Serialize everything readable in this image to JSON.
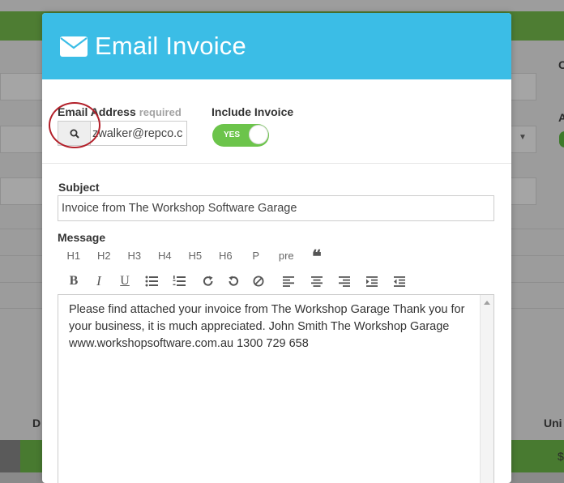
{
  "modal": {
    "title": "Email Invoice",
    "icon": "envelope-icon",
    "header_color": "#3bbde6"
  },
  "email": {
    "label": "Email Address",
    "required_label": "required",
    "value": "zwalker@repco.c",
    "search_icon": "search-icon"
  },
  "include_invoice": {
    "label": "Include Invoice",
    "toggle_text": "YES",
    "on_color": "#6cc44b"
  },
  "subject": {
    "label": "Subject",
    "value": "Invoice from The Workshop Software Garage"
  },
  "message": {
    "label": "Message",
    "headings": [
      "H1",
      "H2",
      "H3",
      "H4",
      "H5",
      "H6",
      "P",
      "pre"
    ],
    "quote_glyph": "❝",
    "toolbar": {
      "bold": "B",
      "italic": "I",
      "underline": "U",
      "icons": [
        "unordered-list-icon",
        "ordered-list-icon",
        "redo-icon",
        "undo-icon",
        "clear-format-icon",
        "align-left-icon",
        "align-center-icon",
        "align-right-icon",
        "indent-icon",
        "outdent-icon"
      ]
    },
    "body": "Please find attached your invoice from The Workshop Garage Thank you for your business, it is much appreciated. John Smith The Workshop Garage www.workshopsoftware.com.au 1300 729 658"
  },
  "background": {
    "left_label": "D",
    "right_label_top": "C",
    "right_label_mid": "A",
    "right_label_bottom": "Uni",
    "right_symbol": "$",
    "green_color": "#4e7d33"
  }
}
